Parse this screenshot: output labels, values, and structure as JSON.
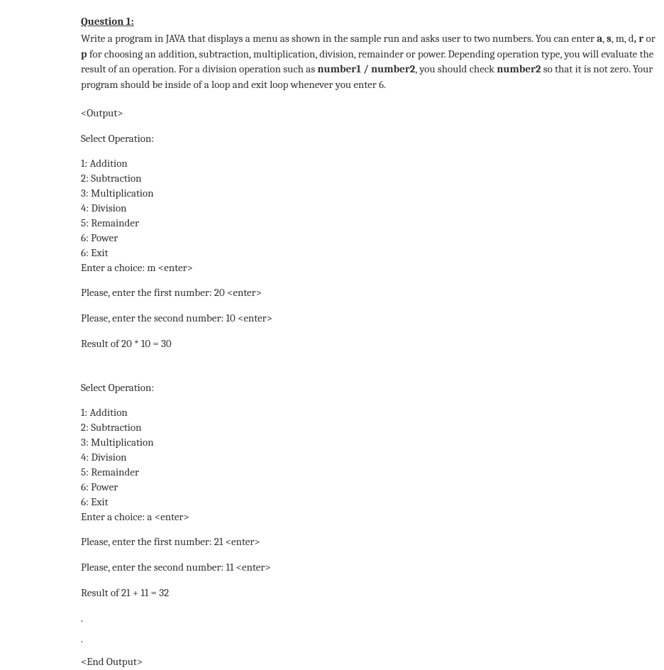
{
  "title": "Question 1:",
  "intro": {
    "part1": "Write a program in JAVA that displays a menu as shown in the sample run and asks user to two numbers. You can enter ",
    "bold1": "a",
    "part2": ", ",
    "bold2": "s",
    "part3": ", m, d",
    "bold3": ", r",
    "part4": "  or ",
    "bold4": "p",
    "part5": " for choosing an addition, subtraction, multiplication, division, remainder or power. Depending operation type, you will evaluate the result of an operation. For a division operation such as ",
    "bold5": "number1 / number2",
    "part6": ", you should check ",
    "bold6": "number2",
    "part7": " so that it is not zero. Your program should be inside of a loop and exit loop whenever you enter 6."
  },
  "outputStart": "<Output>",
  "selectOperation": "Select Operation:",
  "menu": {
    "line1": "1: Addition",
    "line2": "2: Subtraction",
    "line3": "3: Multiplication",
    "line4": "4: Division",
    "line5": "5: Remainder",
    "line6": "6: Power",
    "line7": "6: Exit"
  },
  "run1": {
    "enterChoice": "Enter a choice: m <enter>",
    "firstNumber": "Please, enter the first number: 20 <enter>",
    "secondNumber": "Please, enter the second number: 10 <enter>",
    "result": "Result of 20 * 10 = 30"
  },
  "run2": {
    "enterChoice": "Enter a choice: a <enter>",
    "firstNumber": "Please, enter the first number: 21 <enter>",
    "secondNumber": "Please, enter the second number: 11 <enter>",
    "result": "Result of 21 + 11 = 32"
  },
  "dot": ".",
  "outputEnd": "<End Output>"
}
